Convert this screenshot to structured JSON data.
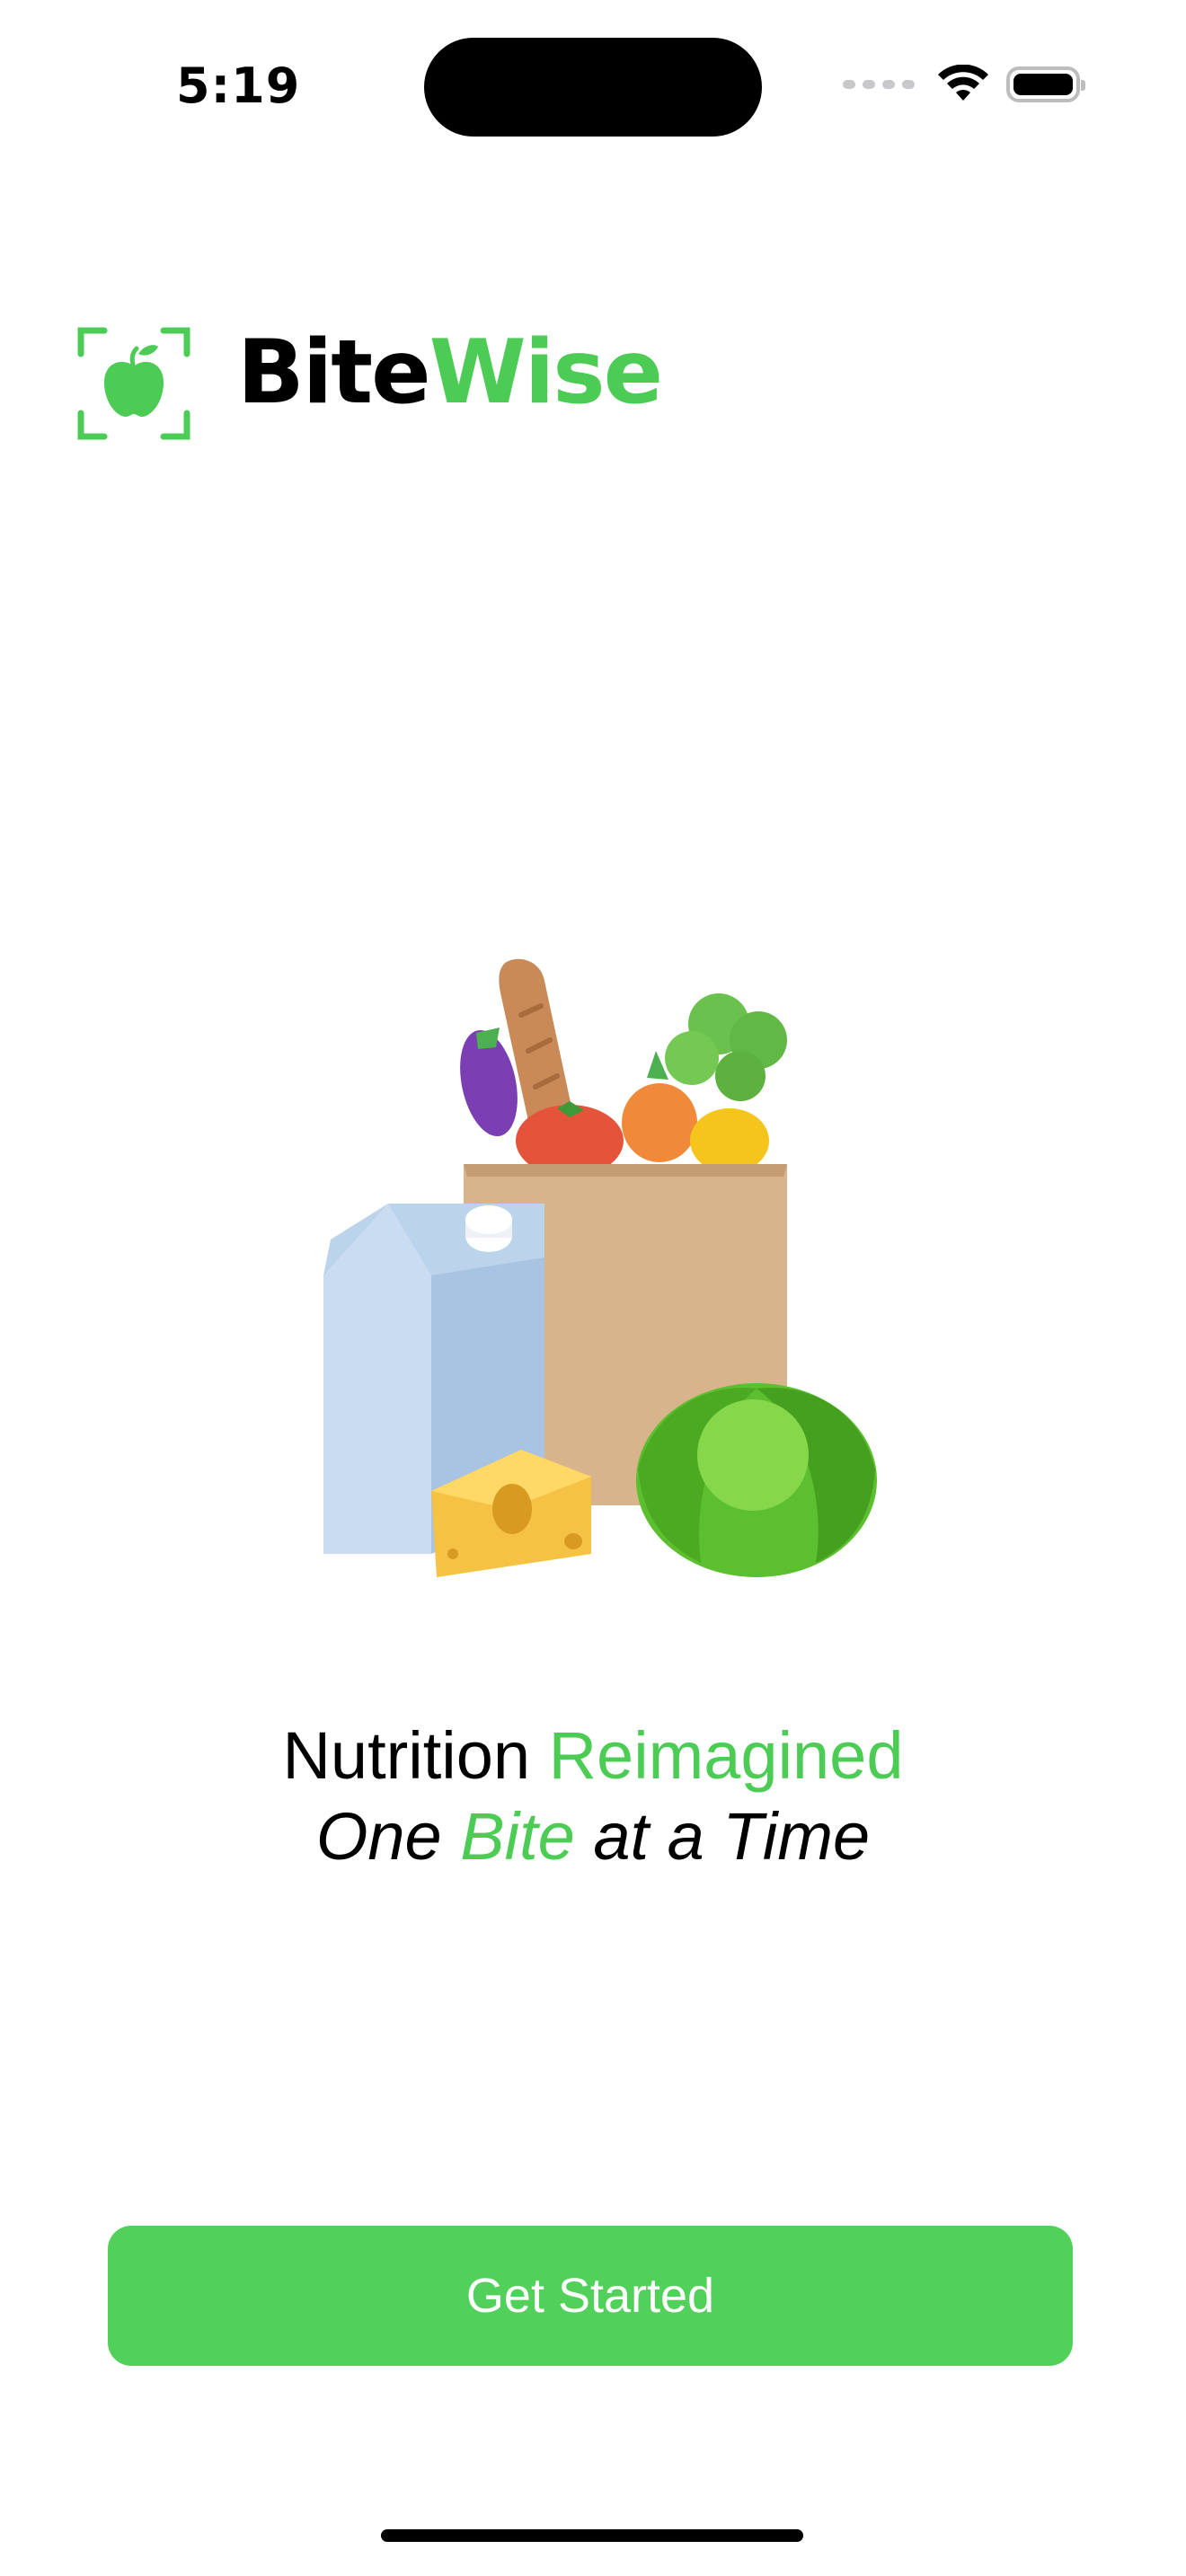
{
  "status_bar": {
    "time": "5:19"
  },
  "brand": {
    "part1": "Bite",
    "part2": "Wise",
    "accent_color": "#4ccc55",
    "logo_icon": "apple-scan-icon"
  },
  "illustration": {
    "icon": "grocery-bag-illustration"
  },
  "tagline": {
    "line1_a": "Nutrition ",
    "line1_b": "Reimagined",
    "line2_a": "One ",
    "line2_b": "Bite",
    "line2_c": " at a Time"
  },
  "cta": {
    "label": "Get Started",
    "color": "#52d15a"
  }
}
